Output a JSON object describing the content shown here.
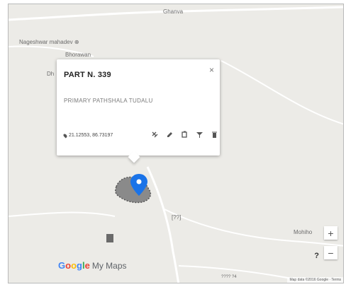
{
  "map": {
    "labels": {
      "top": "Ghanva",
      "left": "Nageshwar mahadev ⊕",
      "village": "Bhorawan",
      "popup_left_edge": "Dh",
      "right": "Mohiho",
      "road_mid": "[??]",
      "road_bottom": "???? ?4"
    },
    "attribution": "Map data ©2016 Google · Terms"
  },
  "popup": {
    "title": "PART N. 339",
    "close_glyph": "×",
    "subtitle": "PRIMARY PATHSHALA TUDALU",
    "coordinates": "21.12553, 86.73197",
    "tools": [
      "style-icon",
      "edit-icon",
      "copy-icon",
      "filter-icon",
      "delete-icon"
    ]
  },
  "controls": {
    "zoom_in": "+",
    "zoom_out": "−",
    "help": "?"
  },
  "branding": {
    "logo_letters": [
      "G",
      "o",
      "o",
      "g",
      "l",
      "e"
    ],
    "product": "My Maps"
  },
  "colors": {
    "marker": "#1a73e8",
    "polygon_fill": "#8a8a8a",
    "land": "#ecebe7",
    "road": "#ffffff",
    "brand": [
      "#4285F4",
      "#EA4335",
      "#FBBC05",
      "#4285F4",
      "#34A853",
      "#EA4335"
    ]
  }
}
